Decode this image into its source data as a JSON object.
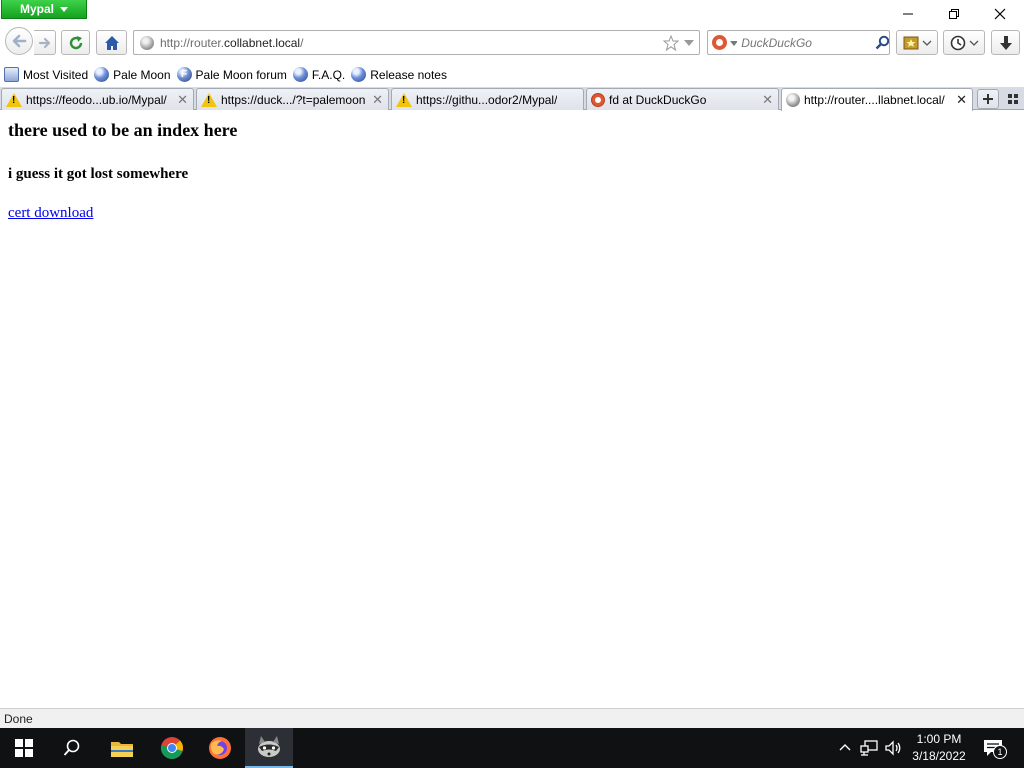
{
  "app": {
    "menu_label": "Mypal"
  },
  "nav": {
    "url_prefix": "http://router.",
    "url_host": "collabnet.local",
    "url_suffix": "/",
    "search_placeholder": "DuckDuckGo"
  },
  "bookmarks": [
    {
      "label": "Most Visited",
      "icon": "most-visited-icon"
    },
    {
      "label": "Pale Moon",
      "icon": "globe-icon"
    },
    {
      "label": "Pale Moon forum",
      "icon": "forum-icon"
    },
    {
      "label": "F.A.Q.",
      "icon": "globe-icon"
    },
    {
      "label": "Release notes",
      "icon": "globe-icon"
    }
  ],
  "tabs": [
    {
      "label": "https://feodo...ub.io/Mypal/",
      "icon": "warning-icon",
      "active": false
    },
    {
      "label": "https://duck.../?t=palemoon",
      "icon": "warning-icon",
      "active": false
    },
    {
      "label": "https://githu...odor2/Mypal/",
      "icon": "warning-icon",
      "active": false
    },
    {
      "label": "fd at DuckDuckGo",
      "icon": "duckduckgo-icon",
      "active": false
    },
    {
      "label": "http://router....llabnet.local/",
      "icon": "globe-icon",
      "active": true
    }
  ],
  "page": {
    "heading": "there used to be an index here",
    "subheading": "i guess it got lost somewhere",
    "link_text": "cert download"
  },
  "status": {
    "text": "Done"
  },
  "taskbar": {
    "time": "1:00 PM",
    "date": "3/18/2022",
    "notification_count": "1"
  },
  "colors": {
    "app_button": "#14a21f",
    "link": "#0000ee",
    "taskbar": "#0f1113",
    "tabstrip": "#d6dbe4"
  }
}
